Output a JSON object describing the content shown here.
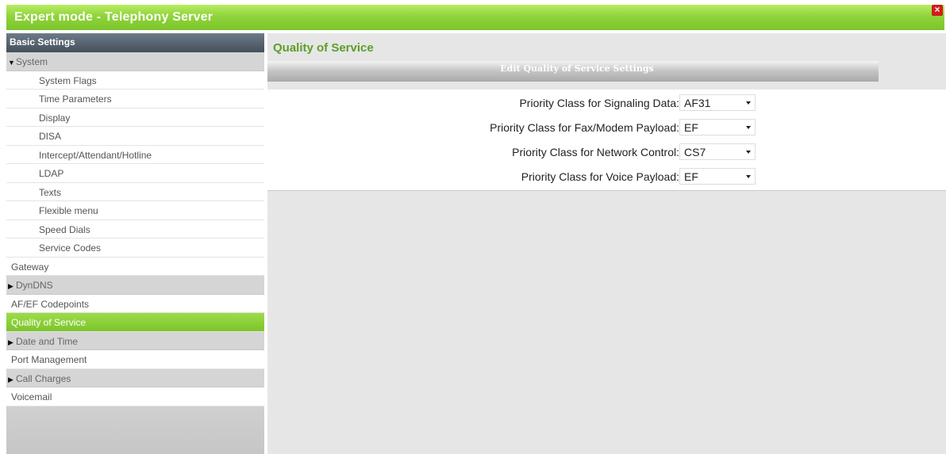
{
  "window": {
    "title": "Expert mode - Telephony Server",
    "close_glyph": "×"
  },
  "sidebar": {
    "header": "Basic Settings",
    "items": [
      {
        "label": "System",
        "kind": "group",
        "expanded": true
      },
      {
        "label": "System Flags",
        "kind": "sub"
      },
      {
        "label": "Time Parameters",
        "kind": "sub"
      },
      {
        "label": "Display",
        "kind": "sub"
      },
      {
        "label": "DISA",
        "kind": "sub"
      },
      {
        "label": "Intercept/Attendant/Hotline",
        "kind": "sub"
      },
      {
        "label": "LDAP",
        "kind": "sub"
      },
      {
        "label": "Texts",
        "kind": "sub"
      },
      {
        "label": "Flexible menu",
        "kind": "sub"
      },
      {
        "label": "Speed Dials",
        "kind": "sub"
      },
      {
        "label": "Service Codes",
        "kind": "sub"
      },
      {
        "label": "Gateway",
        "kind": "top"
      },
      {
        "label": "DynDNS",
        "kind": "group",
        "expanded": false
      },
      {
        "label": "AF/EF Codepoints",
        "kind": "top"
      },
      {
        "label": "Quality of Service",
        "kind": "top",
        "active": true
      },
      {
        "label": "Date and Time",
        "kind": "group",
        "expanded": false
      },
      {
        "label": "Port Management",
        "kind": "top"
      },
      {
        "label": "Call Charges",
        "kind": "group",
        "expanded": false
      },
      {
        "label": "Voicemail",
        "kind": "top"
      }
    ]
  },
  "main": {
    "title": "Quality of Service",
    "section_header": "Edit Quality of Service Settings",
    "fields": [
      {
        "label": "Priority Class for Signaling Data:",
        "value": "AF31"
      },
      {
        "label": "Priority Class for Fax/Modem Payload:",
        "value": "EF"
      },
      {
        "label": "Priority Class for Network Control:",
        "value": "CS7"
      },
      {
        "label": "Priority Class for Voice Payload:",
        "value": "EF"
      }
    ]
  },
  "colors": {
    "accent_green": "#7cc52b",
    "title_green": "#5c9e26",
    "close_red": "#d11d1d"
  }
}
